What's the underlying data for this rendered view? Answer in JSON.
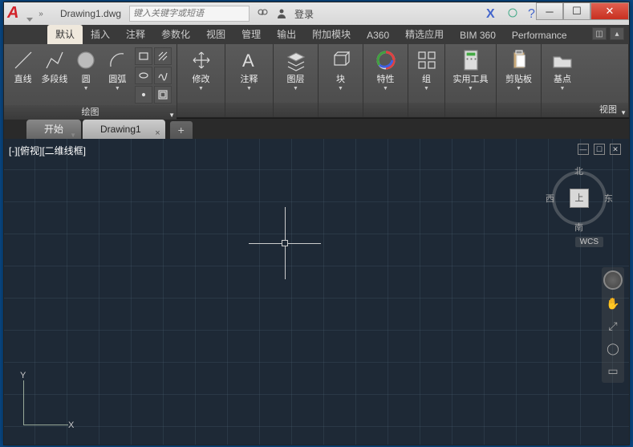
{
  "title": {
    "filename": "Drawing1.dwg",
    "search_placeholder": "键入关键字或短语",
    "login": "登录"
  },
  "ribbon_tabs": [
    "默认",
    "插入",
    "注释",
    "参数化",
    "视图",
    "管理",
    "输出",
    "附加模块",
    "A360",
    "精选应用",
    "BIM 360",
    "Performance"
  ],
  "panels": {
    "draw": {
      "label": "绘图",
      "line": "直线",
      "polyline": "多段线",
      "circle": "圆",
      "arc": "圆弧"
    },
    "modify": {
      "label": "修改"
    },
    "annotate": {
      "label": "注释"
    },
    "layer": {
      "label": "图层"
    },
    "block": {
      "label": "块"
    },
    "properties": {
      "label": "特性"
    },
    "group": {
      "label": "组"
    },
    "utilities": {
      "label": "实用工具"
    },
    "clipboard": {
      "label": "剪贴板"
    },
    "basepoint": {
      "label": "基点"
    },
    "view": {
      "label": "视图"
    }
  },
  "doc_tabs": {
    "start": "开始",
    "drawing": "Drawing1"
  },
  "viewport": {
    "label": "[-][俯视][二维线框]"
  },
  "viewcube": {
    "top": "上",
    "n": "北",
    "s": "南",
    "e": "东",
    "w": "西",
    "wcs": "WCS"
  },
  "ucs": {
    "x": "X",
    "y": "Y"
  }
}
